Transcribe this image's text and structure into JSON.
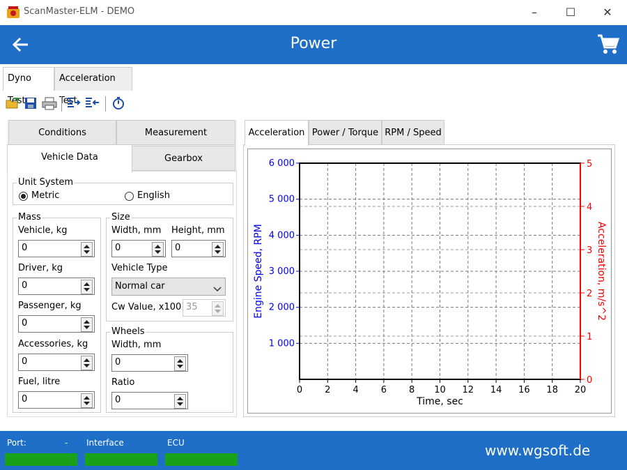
{
  "window": {
    "title": "ScanMaster-ELM - DEMO"
  },
  "header": {
    "title": "Power"
  },
  "top_tabs": [
    {
      "label": "Dyno Test",
      "active": true
    },
    {
      "label": "Acceleration Test",
      "active": false
    }
  ],
  "toolbar": {
    "icons": [
      "open-folder-icon",
      "save-icon",
      "print-icon",
      "indent-right-icon",
      "indent-left-icon",
      "stopwatch-icon"
    ]
  },
  "left_tabs": {
    "row1": [
      "Conditions",
      "Measurement"
    ],
    "row2": [
      "Vehicle Data",
      "Gearbox"
    ],
    "active": "Vehicle Data"
  },
  "unit_system": {
    "label": "Unit System",
    "options": [
      "Metric",
      "English"
    ],
    "selected": "Metric"
  },
  "mass": {
    "label": "Mass",
    "fields": [
      {
        "label": "Vehicle, kg",
        "value": "0"
      },
      {
        "label": "Driver, kg",
        "value": "0"
      },
      {
        "label": "Passenger, kg",
        "value": "0"
      },
      {
        "label": "Accessories, kg",
        "value": "0"
      },
      {
        "label": "Fuel, litre",
        "value": "0"
      }
    ]
  },
  "size": {
    "label": "Size",
    "width_label": "Width, mm",
    "width_value": "0",
    "height_label": "Height, mm",
    "height_value": "0",
    "vehicle_type_label": "Vehicle Type",
    "vehicle_type_value": "Normal car",
    "cw_label": "Cw Value, x100",
    "cw_value": "35"
  },
  "wheels": {
    "label": "Wheels",
    "width_label": "Width, mm",
    "width_value": "0",
    "ratio_label": "Ratio",
    "ratio_value": "0"
  },
  "right_tabs": [
    {
      "label": "Acceleration",
      "active": true
    },
    {
      "label": "Power / Torque",
      "active": false
    },
    {
      "label": "RPM / Speed",
      "active": false
    }
  ],
  "chart_data": {
    "type": "line",
    "xlabel": "Time, sec",
    "ylabel": "Engine Speed, RPM",
    "y2label": "Acceleration, m/s^2",
    "xlim": [
      0,
      20
    ],
    "ylim": [
      0,
      6000
    ],
    "y2lim": [
      0,
      5
    ],
    "x_ticks": [
      "0",
      "2",
      "4",
      "6",
      "8",
      "10",
      "12",
      "14",
      "16",
      "18",
      "20"
    ],
    "y_ticks": [
      "1 000",
      "2 000",
      "3 000",
      "4 000",
      "5 000",
      "6 000"
    ],
    "y2_ticks": [
      "0",
      "1",
      "2",
      "3",
      "4",
      "5"
    ],
    "grid": true,
    "series": [],
    "colors": {
      "left_axis": "#0000ff",
      "right_axis": "#ff0000"
    }
  },
  "footer": {
    "port_label": "Port:",
    "port_value": "-",
    "interface_label": "Interface",
    "ecu_label": "ECU",
    "url": "www.wgsoft.de"
  }
}
